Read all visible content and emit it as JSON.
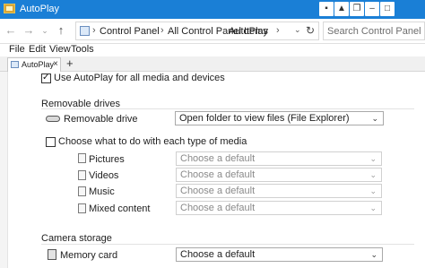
{
  "window": {
    "title": "AutoPlay"
  },
  "addressbar": {
    "breadcrumbs": [
      "Control Panel",
      "All Control Panel Items",
      "AutoPlay"
    ],
    "search_placeholder": "Search Control Panel"
  },
  "menu": {
    "items": [
      "File",
      "Edit",
      "View",
      "Tools"
    ]
  },
  "tabs": {
    "active_label": "AutoPlay",
    "close_glyph": "×",
    "new_tab_glyph": "+"
  },
  "content": {
    "use_autoplay": {
      "label": "Use AutoPlay for all media and devices",
      "checked": true
    },
    "removable_drives": {
      "section_title": "Removable drives",
      "drive_label": "Removable drive",
      "drive_value": "Open folder to view files (File Explorer)"
    },
    "media": {
      "choose_label": "Choose what to do with each type of media",
      "choose_checked": false,
      "items": [
        {
          "label": "Pictures",
          "value": "Choose a default",
          "icon": "pictures-icon"
        },
        {
          "label": "Videos",
          "value": "Choose a default",
          "icon": "videos-icon"
        },
        {
          "label": "Music",
          "value": "Choose a default",
          "icon": "music-icon"
        },
        {
          "label": "Mixed content",
          "value": "Choose a default",
          "icon": "mixed-content-icon"
        }
      ]
    },
    "camera_storage": {
      "section_title": "Camera storage",
      "memory_card_label": "Memory card",
      "memory_card_value": "Choose a default"
    }
  },
  "colors": {
    "titlebar": "#1a7fd6",
    "text": "#1e1e1e"
  }
}
